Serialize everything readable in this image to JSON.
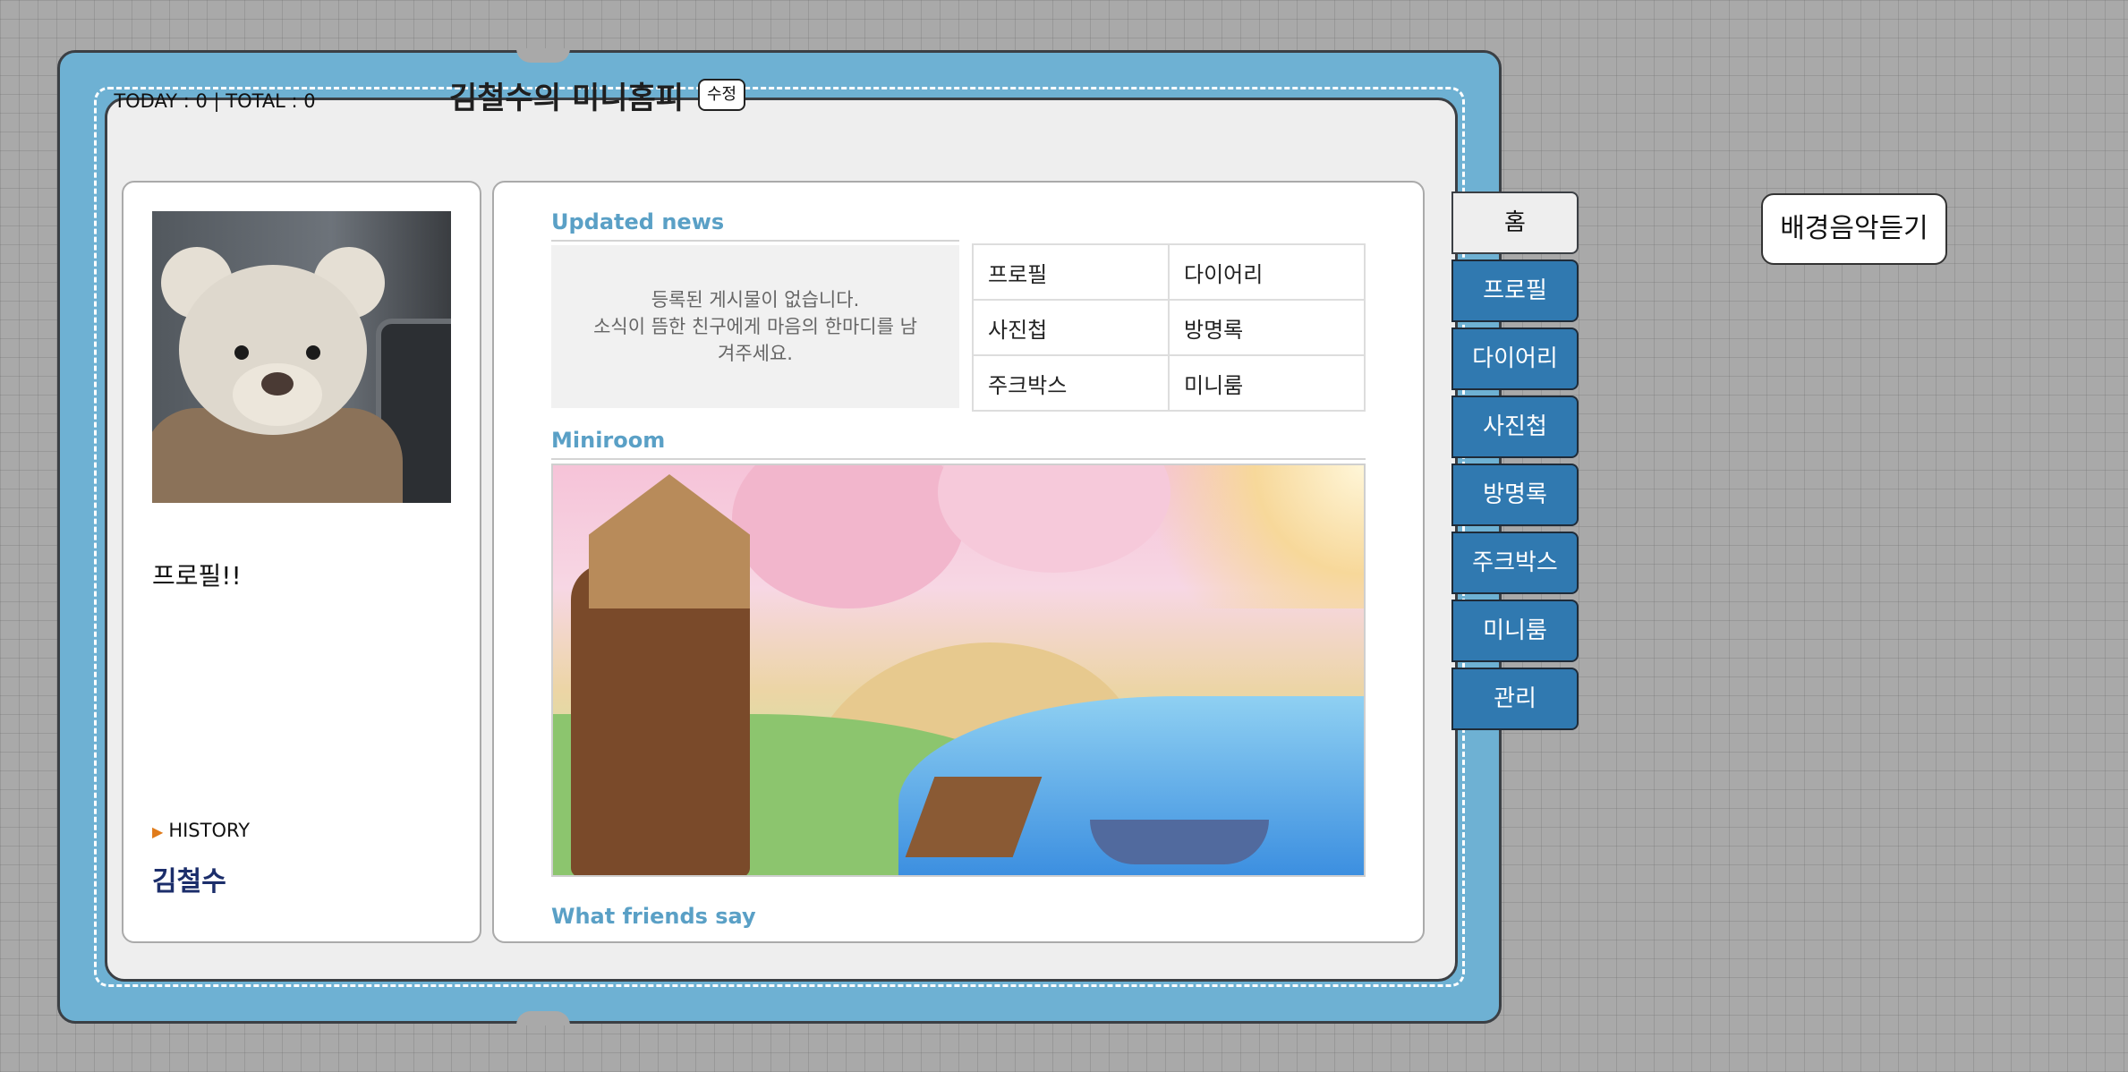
{
  "counter": {
    "text": "TODAY : 0 | TOTAL : 0"
  },
  "header": {
    "title": "김철수의 미니홈피",
    "edit_label": "수정"
  },
  "profile": {
    "avatar_icon": "teddy-bear-photo",
    "text": "프로필!!",
    "history_label": "HISTORY",
    "name": "김철수"
  },
  "updated_news": {
    "title": "Updated news",
    "empty_line1": "등록된 게시물이 없습니다.",
    "empty_line2": "소식이 뜸한 친구에게 마음의 한마디를 남",
    "empty_line3": "겨주세요."
  },
  "menu_grid": [
    {
      "label": "프로필"
    },
    {
      "label": "다이어리"
    },
    {
      "label": "사진첩"
    },
    {
      "label": "방명록"
    },
    {
      "label": "주크박스"
    },
    {
      "label": "미니룸"
    }
  ],
  "miniroom": {
    "title": "Miniroom"
  },
  "friends": {
    "title": "What friends say"
  },
  "tabs": [
    {
      "label": "홈",
      "active": true
    },
    {
      "label": "프로필"
    },
    {
      "label": "다이어리"
    },
    {
      "label": "사진첩"
    },
    {
      "label": "방명록"
    },
    {
      "label": "주크박스"
    },
    {
      "label": "미니룸"
    },
    {
      "label": "관리"
    }
  ],
  "bgm": {
    "label": "배경음악듣기"
  },
  "colors": {
    "frame": "#6eb1d3",
    "tab": "#3079b0",
    "section_title": "#5aa0c6",
    "owner_name": "#1c2e6b"
  }
}
